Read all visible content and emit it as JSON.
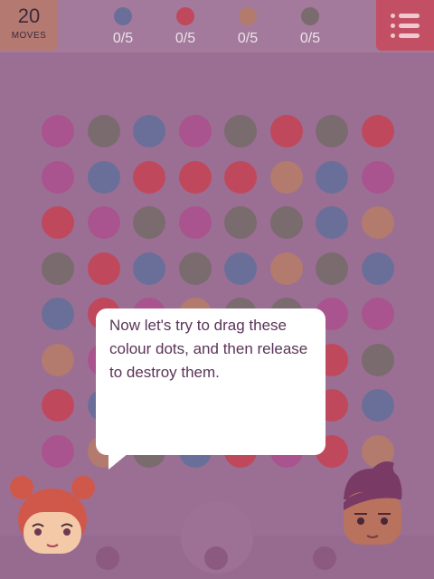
{
  "moves": {
    "count": "20",
    "label": "MOVES"
  },
  "goals": [
    {
      "color": "#6a6f9a",
      "progress": "0/5"
    },
    {
      "color": "#c0485d",
      "progress": "0/5"
    },
    {
      "color": "#b37a6e",
      "progress": "0/5"
    },
    {
      "color": "#7a6b6e",
      "progress": "0/5"
    }
  ],
  "menu": {
    "icon": "menu-list-icon"
  },
  "palette": {
    "M": "#a9538f",
    "G": "#7a6b6e",
    "B": "#6a6f9a",
    "R": "#c0485d",
    "O": "#b37a6e"
  },
  "board": [
    "MGBMGRGR",
    "MBRRROBM",
    "RMGMGGBO",
    "GRBGBOGB",
    "BRMOGGMM",
    "OMGRGRRG",
    "RBGRGRRB",
    "MOGBRMRO"
  ],
  "tutorial": {
    "message": "Now let's try to drag these colour dots, and then release to destroy them."
  },
  "characters": {
    "left": "girl-character",
    "right": "boy-character"
  }
}
